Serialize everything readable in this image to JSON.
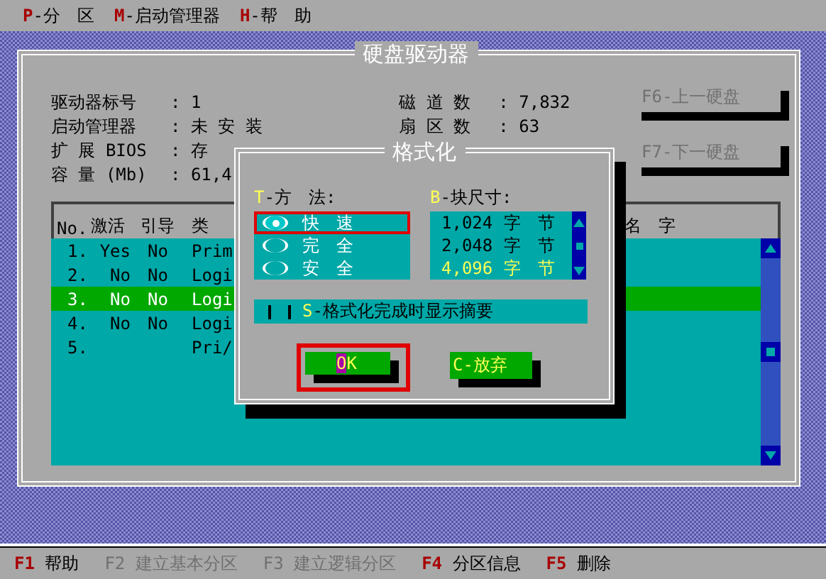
{
  "menu": [
    {
      "hotkey": "P",
      "label": "-分　区"
    },
    {
      "hotkey": "M",
      "label": "-启动管理器"
    },
    {
      "hotkey": "H",
      "label": "-帮　助"
    }
  ],
  "window": {
    "title": "硬盘驱动器",
    "info_left": [
      {
        "label": "驱动器标号",
        "value": ":  1"
      },
      {
        "label": "启动管理器",
        "value": ": 未 安 装"
      },
      {
        "label": "扩 展 BIOS",
        "value": ": 存"
      },
      {
        "label": "容 量 (Mb)",
        "value": ": 61,4"
      }
    ],
    "info_right": [
      {
        "label": "磁 道 数",
        "value": ": 7,832"
      },
      {
        "label": "扇 区 数",
        "value": ": 63"
      }
    ],
    "buttons": [
      {
        "label": "F6-上一硬盘",
        "disabled": true
      },
      {
        "label": "F7-下一硬盘",
        "disabled": true
      }
    ],
    "table": {
      "columns": [
        "No.",
        "激活",
        "引导",
        "类"
      ],
      "column_5": "名　字",
      "rows": [
        {
          "no": "1.",
          "active": "Yes",
          "boot": "No",
          "type": "Prim",
          "selected": false
        },
        {
          "no": "2.",
          "active": "No",
          "boot": "No",
          "type": "Logi",
          "selected": false
        },
        {
          "no": "3.",
          "active": "No",
          "boot": "No",
          "type": "Logi",
          "selected": true
        },
        {
          "no": "4.",
          "active": "No",
          "boot": "No",
          "type": "Logi",
          "selected": false
        },
        {
          "no": "5.",
          "type": "Pri/",
          "selected": false
        }
      ]
    }
  },
  "dialog": {
    "title": "格式化",
    "method": {
      "hotkey": "T",
      "label": "-方　法:",
      "options": [
        {
          "label": "快　速",
          "selected": true,
          "focused": true
        },
        {
          "label": "完　全",
          "selected": false,
          "focused": false
        },
        {
          "label": "安　全",
          "selected": false,
          "focused": false
        }
      ]
    },
    "block_size": {
      "hotkey": "B",
      "label": "-块尺寸:",
      "options": [
        {
          "size": "1,024",
          "unit": "字　节",
          "selected": false
        },
        {
          "size": "2,048",
          "unit": "字　节",
          "selected": false
        },
        {
          "size": "4,096",
          "unit": "字　节",
          "selected": true
        }
      ]
    },
    "summary": {
      "checked": false,
      "hotkey": "S",
      "label": "-格式化完成时显示摘要"
    },
    "buttons": [
      {
        "kind": "ok",
        "hotkey": "O",
        "label": "K",
        "focused": true
      },
      {
        "kind": "cancel",
        "hotkey": "C",
        "label": "-放弃",
        "focused": false
      }
    ]
  },
  "status_bar": [
    {
      "key": "F1",
      "label": "帮助",
      "disabled": false
    },
    {
      "key": "F2",
      "label": "建立基本分区",
      "disabled": true
    },
    {
      "key": "F3",
      "label": "建立逻辑分区",
      "disabled": true
    },
    {
      "key": "F4",
      "label": "分区信息",
      "disabled": false
    },
    {
      "key": "F5",
      "label": "删除",
      "disabled": false
    }
  ]
}
